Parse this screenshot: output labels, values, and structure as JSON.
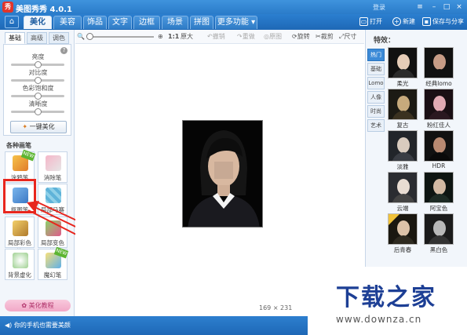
{
  "window": {
    "app_title": "美图秀秀 4.0.1",
    "login": "登录",
    "logo_text": "秀"
  },
  "tabs": [
    {
      "label": "美化",
      "active": true
    },
    {
      "label": "美容"
    },
    {
      "label": "饰品"
    },
    {
      "label": "文字"
    },
    {
      "label": "边框"
    },
    {
      "label": "场景"
    },
    {
      "label": "拼图"
    },
    {
      "label": "更多功能"
    }
  ],
  "header_actions": {
    "open": "打开",
    "new": "新建",
    "save_share": "保存与分享"
  },
  "left_panel": {
    "subtabs": [
      "基础",
      "高级",
      "调色"
    ],
    "adjustments": [
      {
        "label": "亮度",
        "value": 0.5
      },
      {
        "label": "对比度",
        "value": 0.5
      },
      {
        "label": "色彩饱和度",
        "value": 0.5
      },
      {
        "label": "清晰度",
        "value": 0.5
      }
    ],
    "one_click": "一键美化",
    "section_title": "各种画笔",
    "tools": [
      {
        "label": "涂鸦笔",
        "badge": "NEW"
      },
      {
        "label": "消除笔"
      },
      {
        "label": "抠图笔"
      },
      {
        "label": "局部马赛克"
      },
      {
        "label": "局部彩色笔"
      },
      {
        "label": "局部变色笔"
      },
      {
        "label": "背景虚化"
      },
      {
        "label": "魔幻笔",
        "badge": "NEW"
      }
    ],
    "tutorial": "美化教程"
  },
  "canvas_toolbar": {
    "ratio": "1:1",
    "original": "原大",
    "undo": "撤销",
    "redo": "重做",
    "restore": "原图",
    "rotate": "旋转",
    "crop": "裁剪",
    "size": "尺寸"
  },
  "canvas": {
    "image_size": "169 × 231"
  },
  "right_panel": {
    "title": "特效：",
    "categories": [
      "热门",
      "基础",
      "Lomo",
      "人像",
      "时尚",
      "艺术"
    ],
    "effects": [
      "柔光",
      "经典lomo",
      "复古",
      "粉红佳人",
      "淡雅",
      "HDR",
      "云端",
      "阿宝色",
      "后青春",
      "黑白色"
    ]
  },
  "bottom": {
    "tip": "你的手机也需要美颜"
  },
  "watermark": {
    "title": "下载之家",
    "url": "www.downza.cn"
  },
  "colors": {
    "brand_blue": "#2a7bc9",
    "highlight_red": "#e8261e",
    "tutorial_pink": "#f1a7c6"
  }
}
